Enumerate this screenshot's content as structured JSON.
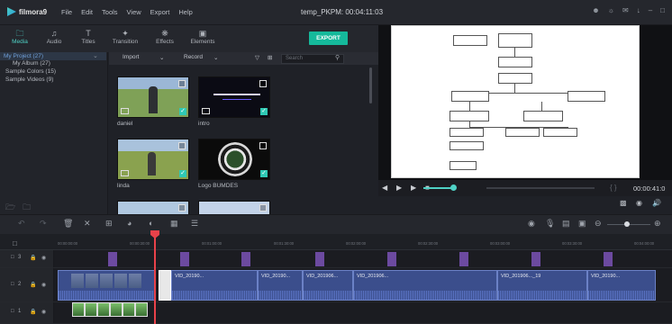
{
  "app": {
    "name": "filmora9",
    "project_title": "temp_PKPM:",
    "project_time": "00:04:11:03"
  },
  "menu": [
    "File",
    "Edit",
    "Tools",
    "View",
    "Export",
    "Help"
  ],
  "toolbar": {
    "tabs": [
      "Media",
      "Audio",
      "Titles",
      "Transition",
      "Effects",
      "Elements"
    ],
    "active": "Media",
    "export_label": "EXPORT"
  },
  "sidebar": {
    "items": [
      "My Project (27)",
      "My Album (27)",
      "Sample Colors (15)",
      "Sample Videos (9)"
    ],
    "selected": 0
  },
  "media_header": {
    "import_label": "Import",
    "record_label": "Record",
    "search_placeholder": "Search"
  },
  "media_items": [
    {
      "label": "daniel"
    },
    {
      "label": "intro"
    },
    {
      "label": "linda"
    },
    {
      "label": "Logo BUMDES"
    },
    {
      "label": ""
    },
    {
      "label": ""
    }
  ],
  "preview": {
    "timecode": "00:00:41:0"
  },
  "ruler": [
    "00:00:00:00",
    "00:00:30:00",
    "00:01:00:00",
    "00:01:30:00",
    "00:02:00:00",
    "00:02:30:00",
    "00:03:00:00",
    "00:03:30:00",
    "00:04:00:00"
  ],
  "tracks": {
    "top_label": "3",
    "video_label": "2",
    "audio_label": "1"
  },
  "clips": [
    "VID_20190...",
    "VID_20190...",
    "VID_201906...",
    "VID_201906...",
    "VID_201906..._19",
    "VID_20190..."
  ],
  "colors": {
    "accent": "#4fd1c5",
    "export": "#15b99b",
    "playhead": "#e8424a",
    "clip": "#3b4e8c"
  }
}
